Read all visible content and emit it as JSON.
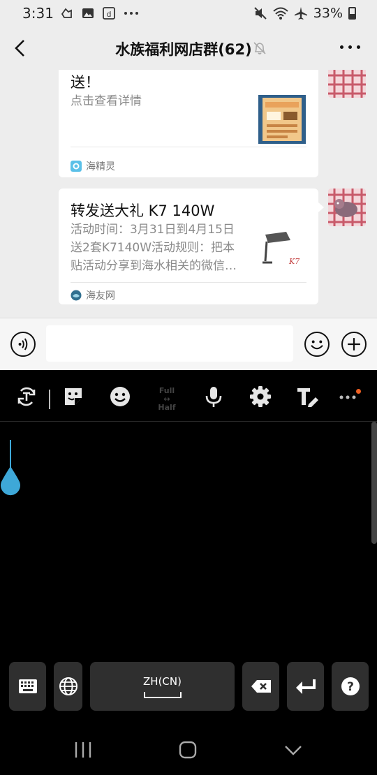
{
  "status_bar": {
    "time": "3:31",
    "battery": "33%",
    "left_icons": [
      "notification-icon",
      "image-icon",
      "dict-icon",
      "more-dots-icon"
    ],
    "right_icons": [
      "mute-icon",
      "wifi-icon",
      "airplane-icon",
      "battery-icon"
    ]
  },
  "header": {
    "title": "水族福利网店群(62)",
    "back_icon": "back-arrow-icon",
    "mute_icon": "bell-off-icon",
    "more_icon": "more-icon"
  },
  "messages": [
    {
      "title": "送！",
      "description": "点击查看详情",
      "source": "海精灵",
      "source_icon": "app-logo"
    },
    {
      "title": "转发送大礼 K7 140W",
      "description": "活动时间：3月31日到4月15日送2套K7140W活动规则：把本贴活动分享到海水相关的微信…",
      "description_lines": [
        "活动时间：3月31日到4月15日",
        "送2套K7140W活动规则：把本",
        "贴活动分享到海水相关的微信…"
      ],
      "source": "海友网",
      "source_icon": "site-logo"
    }
  ],
  "input_bar": {
    "voice_icon": "voice-icon",
    "emoji_icon": "emoji-icon",
    "plus_icon": "plus-icon",
    "value": ""
  },
  "keyboard": {
    "toolbar_icons": [
      "switch-keyboard-icon",
      "sticker-icon",
      "emoji-icon",
      "full-half-icon",
      "mic-icon",
      "settings-icon",
      "text-edit-icon",
      "more-icon"
    ],
    "full_label": "Full",
    "half_label": "Half",
    "language_label": "ZH(CN)",
    "keys": [
      "keyboard-icon",
      "globe-icon",
      "space",
      "backspace-icon",
      "enter-icon",
      "help-icon"
    ]
  },
  "navigation": [
    "recents-icon",
    "home-icon",
    "back-icon"
  ],
  "colors": {
    "chat_bg": "#ededed",
    "card_bg": "#ffffff",
    "keyboard_bg": "#000000",
    "key_bg": "#2f2f2f",
    "handle_blue": "#3ea8d8",
    "badge_orange": "#f06022"
  }
}
